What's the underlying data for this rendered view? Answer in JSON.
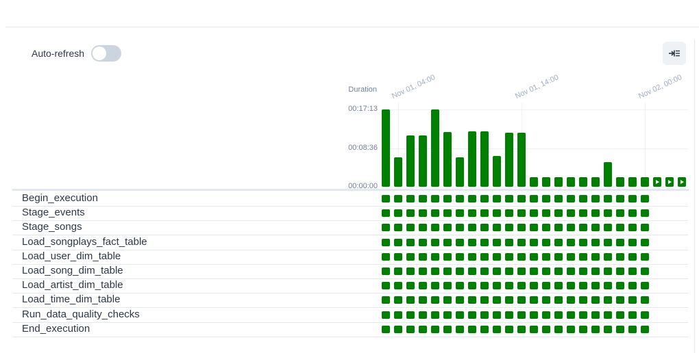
{
  "toolbar": {
    "auto_refresh_label": "Auto-refresh",
    "auto_refresh_on": false,
    "collapse_icon": "collapse-panel-icon"
  },
  "chart_data": {
    "type": "bar",
    "title": "Duration",
    "ytick_labels": [
      "00:17:13",
      "00:08:36",
      "00:00:00"
    ],
    "yticks_seconds": [
      1033,
      516,
      0
    ],
    "xtick_labels": [
      "Nov 01, 04:00",
      "Nov 01, 14:00",
      "Nov 02, 00:00"
    ],
    "xtick_run_index": [
      1,
      11,
      21
    ],
    "status_color": "#008000",
    "values_seconds": [
      1030,
      390,
      690,
      690,
      1030,
      730,
      390,
      740,
      740,
      410,
      720,
      720,
      130,
      130,
      130,
      130,
      130,
      130,
      330,
      130,
      130,
      130
    ],
    "queued_runs": 3
  },
  "tasks": [
    {
      "name": "Begin_execution"
    },
    {
      "name": "Stage_events"
    },
    {
      "name": "Stage_songs"
    },
    {
      "name": "Load_songplays_fact_table"
    },
    {
      "name": "Load_user_dim_table"
    },
    {
      "name": "Load_song_dim_table"
    },
    {
      "name": "Load_artist_dim_table"
    },
    {
      "name": "Load_time_dim_table"
    },
    {
      "name": "Run_data_quality_checks"
    },
    {
      "name": "End_execution"
    }
  ],
  "task_instance_count": 22
}
